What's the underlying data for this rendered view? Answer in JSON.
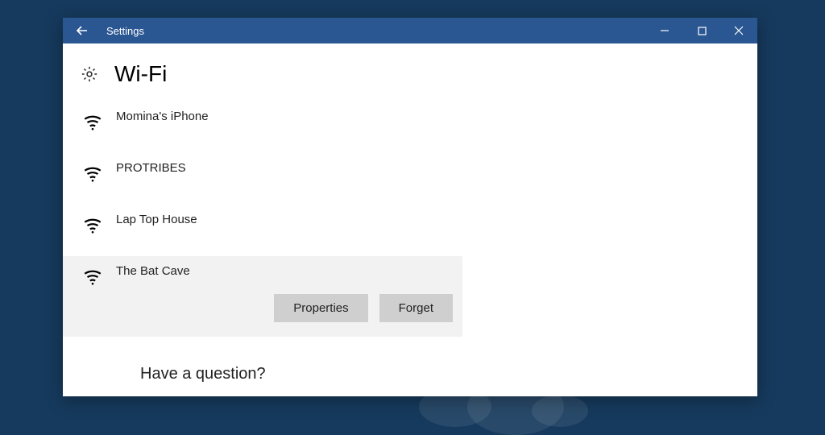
{
  "titlebar": {
    "title": "Settings"
  },
  "page": {
    "heading": "Wi-Fi",
    "question": "Have a question?"
  },
  "networks": [
    {
      "name": "Momina's iPhone"
    },
    {
      "name": "PROTRIBES"
    },
    {
      "name": "Lap Top House"
    },
    {
      "name": "The Bat Cave",
      "selected": true
    }
  ],
  "buttons": {
    "properties": "Properties",
    "forget": "Forget"
  }
}
